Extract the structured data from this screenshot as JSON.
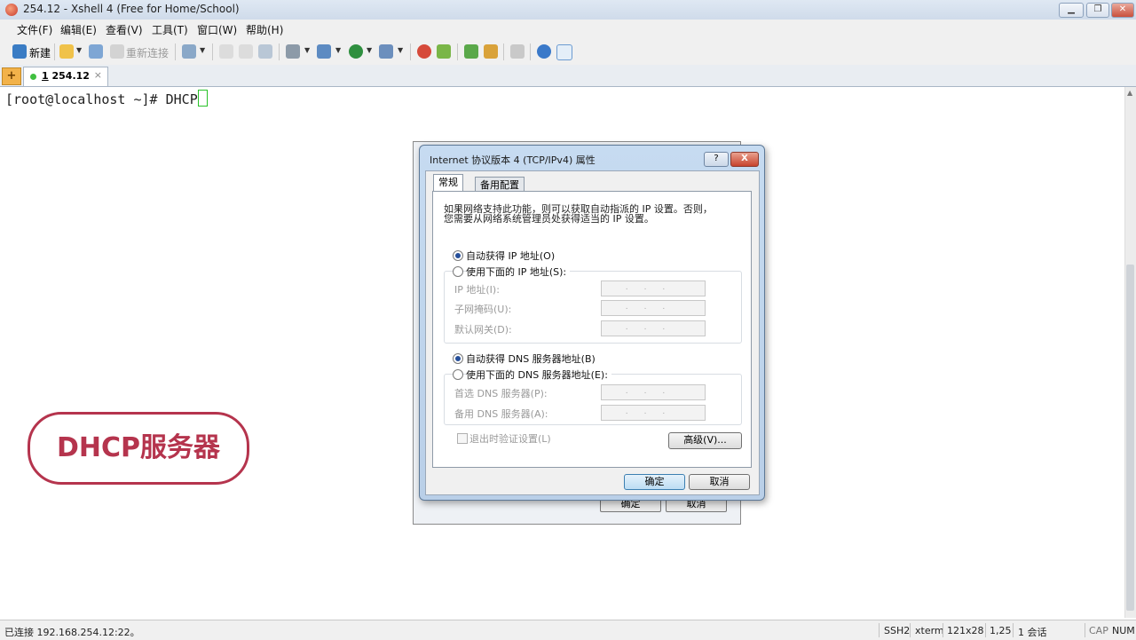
{
  "window": {
    "title": "254.12 - Xshell 4 (Free for Home/School)"
  },
  "menu": [
    "文件(F)",
    "编辑(E)",
    "查看(V)",
    "工具(T)",
    "窗口(W)",
    "帮助(H)"
  ],
  "toolbar": {
    "new_label": "新建",
    "reconnect_label": "重新连接"
  },
  "tabs": [
    {
      "index": "1",
      "label": "254.12",
      "close": "×"
    }
  ],
  "terminal": {
    "line": "[root@localhost ~]# DHCP"
  },
  "badge": {
    "text": "DHCP服务器"
  },
  "background_dialog": {
    "ok": "确定",
    "cancel": "取消"
  },
  "dialog": {
    "title": "Internet 协议版本 4 (TCP/IPv4) 属性",
    "help": "?",
    "close": "X",
    "tabs": [
      "常规",
      "备用配置"
    ],
    "description": [
      "如果网络支持此功能，则可以获取自动指派的 IP 设置。否则，",
      "您需要从网络系统管理员处获得适当的 IP 设置。"
    ],
    "ip_auto": "自动获得 IP 地址(O)",
    "ip_manual": "使用下面的 IP 地址(S):",
    "ip_address_label": "IP 地址(I):",
    "subnet_label": "子网掩码(U):",
    "gateway_label": "默认网关(D):",
    "dns_auto": "自动获得 DNS 服务器地址(B)",
    "dns_manual": "使用下面的 DNS 服务器地址(E):",
    "dns_preferred_label": "首选 DNS 服务器(P):",
    "dns_alternate_label": "备用 DNS 服务器(A):",
    "ip_placeholder": "...",
    "validate_label": "退出时验证设置(L)",
    "advanced": "高级(V)...",
    "ok": "确定",
    "cancel": "取消",
    "ip_mode_selected": "auto",
    "dns_mode_selected": "auto"
  },
  "status": {
    "connection": "已连接 192.168.254.12:22。",
    "protocol": "SSH2",
    "term": "xterm",
    "size": "121x28",
    "cursor": "1,25",
    "sessions": "1 会话",
    "caps": "CAP",
    "num": "NUM"
  },
  "colors": {
    "badge": "#b5344d",
    "cursor": "#28c228",
    "dialog_frame": "#c6dbf1"
  }
}
